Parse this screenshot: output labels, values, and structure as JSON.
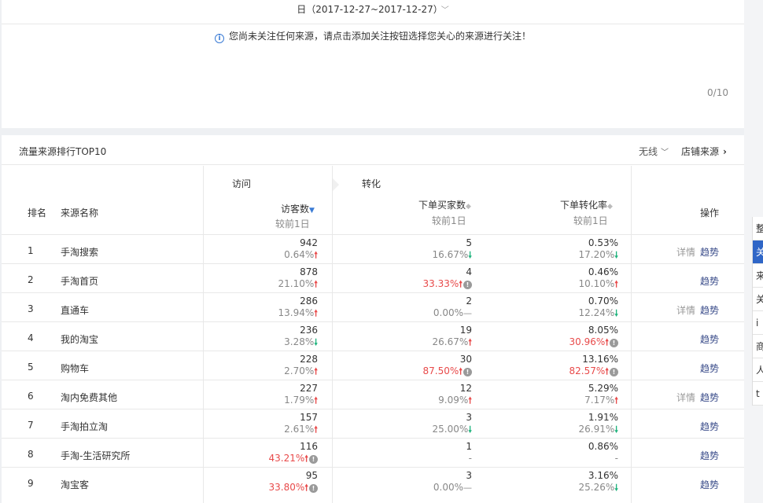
{
  "date_range": "日（2017-12-27~2017-12-27）",
  "notice": "您尚未关注任何来源，请点击添加关注按钮选择您关心的来源进行关注！",
  "follow_counter": "0/10",
  "card": {
    "title": "流量来源排行TOP10",
    "device_filter": "无线",
    "shop_source_label": "店铺来源"
  },
  "headers": {
    "rank": "排名",
    "source_name": "来源名称",
    "group_visit": "访问",
    "group_conversion": "转化",
    "visitors": "访客数",
    "buyers": "下单买家数",
    "conversion_rate": "下单转化率",
    "compare": "较前1日",
    "operations": "操作"
  },
  "op_labels": {
    "detail": "详情",
    "trend": "趋势"
  },
  "rows": [
    {
      "rank": "1",
      "name": "手淘搜索",
      "visitors": "942",
      "visitors_delta": "0.64%",
      "buyers": "5",
      "buyers_delta": "16.67%",
      "rate": "0.53%",
      "rate_delta": "17.20%"
    },
    {
      "rank": "2",
      "name": "手淘首页",
      "visitors": "878",
      "visitors_delta": "21.10%",
      "buyers": "4",
      "buyers_delta": "33.33%",
      "rate": "0.46%",
      "rate_delta": "10.10%"
    },
    {
      "rank": "3",
      "name": "直通车",
      "visitors": "286",
      "visitors_delta": "13.94%",
      "buyers": "2",
      "buyers_delta": "0.00%",
      "rate": "0.70%",
      "rate_delta": "12.24%"
    },
    {
      "rank": "4",
      "name": "我的淘宝",
      "visitors": "236",
      "visitors_delta": "3.28%",
      "buyers": "19",
      "buyers_delta": "26.67%",
      "rate": "8.05%",
      "rate_delta": "30.96%"
    },
    {
      "rank": "5",
      "name": "购物车",
      "visitors": "228",
      "visitors_delta": "2.70%",
      "buyers": "30",
      "buyers_delta": "87.50%",
      "rate": "13.16%",
      "rate_delta": "82.57%"
    },
    {
      "rank": "6",
      "name": "淘内免费其他",
      "visitors": "227",
      "visitors_delta": "1.79%",
      "buyers": "12",
      "buyers_delta": "9.09%",
      "rate": "5.29%",
      "rate_delta": "7.17%"
    },
    {
      "rank": "7",
      "name": "手淘拍立淘",
      "visitors": "157",
      "visitors_delta": "2.61%",
      "buyers": "3",
      "buyers_delta": "25.00%",
      "rate": "1.91%",
      "rate_delta": "26.91%"
    },
    {
      "rank": "8",
      "name": "手淘-生活研究所",
      "visitors": "116",
      "visitors_delta": "43.21%",
      "buyers": "1",
      "buyers_delta": "-",
      "rate": "0.86%",
      "rate_delta": "-"
    },
    {
      "rank": "9",
      "name": "淘宝客",
      "visitors": "95",
      "visitors_delta": "33.80%",
      "buyers": "3",
      "buyers_delta": "0.00%",
      "rate": "3.16%",
      "rate_delta": "25.26%"
    }
  ],
  "side_menu": [
    "整",
    "关",
    "来",
    "关",
    "i",
    "商",
    "人",
    "t"
  ]
}
